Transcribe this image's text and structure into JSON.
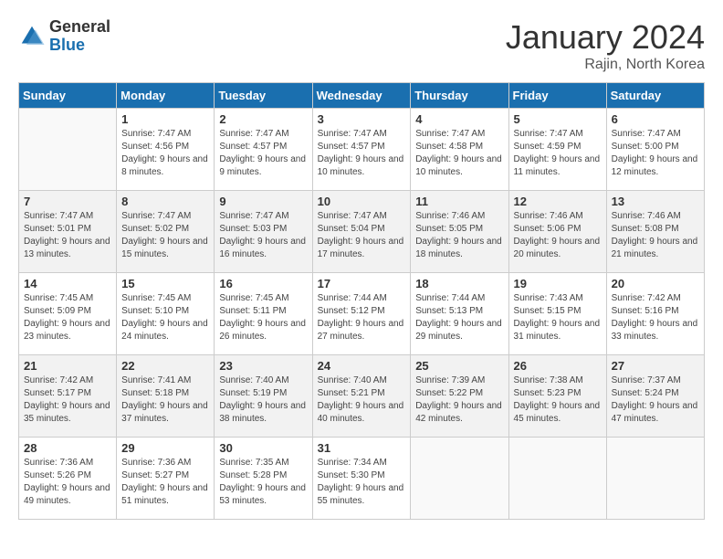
{
  "logo": {
    "general": "General",
    "blue": "Blue"
  },
  "title": "January 2024",
  "location": "Rajin, North Korea",
  "days_header": [
    "Sunday",
    "Monday",
    "Tuesday",
    "Wednesday",
    "Thursday",
    "Friday",
    "Saturday"
  ],
  "weeks": [
    [
      {
        "day": "",
        "sunrise": "",
        "sunset": "",
        "daylight": ""
      },
      {
        "day": "1",
        "sunrise": "Sunrise: 7:47 AM",
        "sunset": "Sunset: 4:56 PM",
        "daylight": "Daylight: 9 hours and 8 minutes."
      },
      {
        "day": "2",
        "sunrise": "Sunrise: 7:47 AM",
        "sunset": "Sunset: 4:57 PM",
        "daylight": "Daylight: 9 hours and 9 minutes."
      },
      {
        "day": "3",
        "sunrise": "Sunrise: 7:47 AM",
        "sunset": "Sunset: 4:57 PM",
        "daylight": "Daylight: 9 hours and 10 minutes."
      },
      {
        "day": "4",
        "sunrise": "Sunrise: 7:47 AM",
        "sunset": "Sunset: 4:58 PM",
        "daylight": "Daylight: 9 hours and 10 minutes."
      },
      {
        "day": "5",
        "sunrise": "Sunrise: 7:47 AM",
        "sunset": "Sunset: 4:59 PM",
        "daylight": "Daylight: 9 hours and 11 minutes."
      },
      {
        "day": "6",
        "sunrise": "Sunrise: 7:47 AM",
        "sunset": "Sunset: 5:00 PM",
        "daylight": "Daylight: 9 hours and 12 minutes."
      }
    ],
    [
      {
        "day": "7",
        "sunrise": "Sunrise: 7:47 AM",
        "sunset": "Sunset: 5:01 PM",
        "daylight": "Daylight: 9 hours and 13 minutes."
      },
      {
        "day": "8",
        "sunrise": "Sunrise: 7:47 AM",
        "sunset": "Sunset: 5:02 PM",
        "daylight": "Daylight: 9 hours and 15 minutes."
      },
      {
        "day": "9",
        "sunrise": "Sunrise: 7:47 AM",
        "sunset": "Sunset: 5:03 PM",
        "daylight": "Daylight: 9 hours and 16 minutes."
      },
      {
        "day": "10",
        "sunrise": "Sunrise: 7:47 AM",
        "sunset": "Sunset: 5:04 PM",
        "daylight": "Daylight: 9 hours and 17 minutes."
      },
      {
        "day": "11",
        "sunrise": "Sunrise: 7:46 AM",
        "sunset": "Sunset: 5:05 PM",
        "daylight": "Daylight: 9 hours and 18 minutes."
      },
      {
        "day": "12",
        "sunrise": "Sunrise: 7:46 AM",
        "sunset": "Sunset: 5:06 PM",
        "daylight": "Daylight: 9 hours and 20 minutes."
      },
      {
        "day": "13",
        "sunrise": "Sunrise: 7:46 AM",
        "sunset": "Sunset: 5:08 PM",
        "daylight": "Daylight: 9 hours and 21 minutes."
      }
    ],
    [
      {
        "day": "14",
        "sunrise": "Sunrise: 7:45 AM",
        "sunset": "Sunset: 5:09 PM",
        "daylight": "Daylight: 9 hours and 23 minutes."
      },
      {
        "day": "15",
        "sunrise": "Sunrise: 7:45 AM",
        "sunset": "Sunset: 5:10 PM",
        "daylight": "Daylight: 9 hours and 24 minutes."
      },
      {
        "day": "16",
        "sunrise": "Sunrise: 7:45 AM",
        "sunset": "Sunset: 5:11 PM",
        "daylight": "Daylight: 9 hours and 26 minutes."
      },
      {
        "day": "17",
        "sunrise": "Sunrise: 7:44 AM",
        "sunset": "Sunset: 5:12 PM",
        "daylight": "Daylight: 9 hours and 27 minutes."
      },
      {
        "day": "18",
        "sunrise": "Sunrise: 7:44 AM",
        "sunset": "Sunset: 5:13 PM",
        "daylight": "Daylight: 9 hours and 29 minutes."
      },
      {
        "day": "19",
        "sunrise": "Sunrise: 7:43 AM",
        "sunset": "Sunset: 5:15 PM",
        "daylight": "Daylight: 9 hours and 31 minutes."
      },
      {
        "day": "20",
        "sunrise": "Sunrise: 7:42 AM",
        "sunset": "Sunset: 5:16 PM",
        "daylight": "Daylight: 9 hours and 33 minutes."
      }
    ],
    [
      {
        "day": "21",
        "sunrise": "Sunrise: 7:42 AM",
        "sunset": "Sunset: 5:17 PM",
        "daylight": "Daylight: 9 hours and 35 minutes."
      },
      {
        "day": "22",
        "sunrise": "Sunrise: 7:41 AM",
        "sunset": "Sunset: 5:18 PM",
        "daylight": "Daylight: 9 hours and 37 minutes."
      },
      {
        "day": "23",
        "sunrise": "Sunrise: 7:40 AM",
        "sunset": "Sunset: 5:19 PM",
        "daylight": "Daylight: 9 hours and 38 minutes."
      },
      {
        "day": "24",
        "sunrise": "Sunrise: 7:40 AM",
        "sunset": "Sunset: 5:21 PM",
        "daylight": "Daylight: 9 hours and 40 minutes."
      },
      {
        "day": "25",
        "sunrise": "Sunrise: 7:39 AM",
        "sunset": "Sunset: 5:22 PM",
        "daylight": "Daylight: 9 hours and 42 minutes."
      },
      {
        "day": "26",
        "sunrise": "Sunrise: 7:38 AM",
        "sunset": "Sunset: 5:23 PM",
        "daylight": "Daylight: 9 hours and 45 minutes."
      },
      {
        "day": "27",
        "sunrise": "Sunrise: 7:37 AM",
        "sunset": "Sunset: 5:24 PM",
        "daylight": "Daylight: 9 hours and 47 minutes."
      }
    ],
    [
      {
        "day": "28",
        "sunrise": "Sunrise: 7:36 AM",
        "sunset": "Sunset: 5:26 PM",
        "daylight": "Daylight: 9 hours and 49 minutes."
      },
      {
        "day": "29",
        "sunrise": "Sunrise: 7:36 AM",
        "sunset": "Sunset: 5:27 PM",
        "daylight": "Daylight: 9 hours and 51 minutes."
      },
      {
        "day": "30",
        "sunrise": "Sunrise: 7:35 AM",
        "sunset": "Sunset: 5:28 PM",
        "daylight": "Daylight: 9 hours and 53 minutes."
      },
      {
        "day": "31",
        "sunrise": "Sunrise: 7:34 AM",
        "sunset": "Sunset: 5:30 PM",
        "daylight": "Daylight: 9 hours and 55 minutes."
      },
      {
        "day": "",
        "sunrise": "",
        "sunset": "",
        "daylight": ""
      },
      {
        "day": "",
        "sunrise": "",
        "sunset": "",
        "daylight": ""
      },
      {
        "day": "",
        "sunrise": "",
        "sunset": "",
        "daylight": ""
      }
    ]
  ]
}
